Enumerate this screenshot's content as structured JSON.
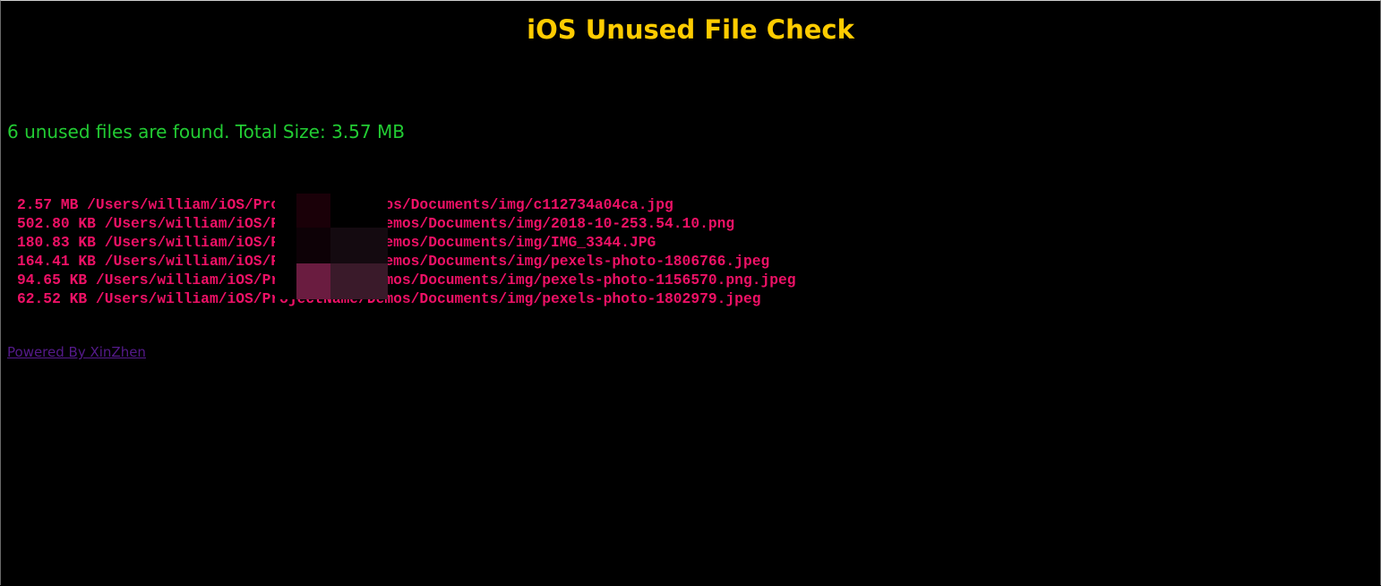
{
  "header": {
    "title": "iOS Unused File Check"
  },
  "summary": {
    "text": "6 unused files are found. Total Size: 3.57 MB"
  },
  "files": [
    {
      "line": "2.57 MB /Users/william/iOS/ProjectName/Demos/Documents/img/c112734a04ca.jpg"
    },
    {
      "line": "502.80 KB /Users/william/iOS/ProjectName/Demos/Documents/img/2018-10-253.54.10.png"
    },
    {
      "line": "180.83 KB /Users/william/iOS/ProjectName/Demos/Documents/img/IMG_3344.JPG"
    },
    {
      "line": "164.41 KB /Users/william/iOS/ProjectName/Demos/Documents/img/pexels-photo-1806766.jpeg"
    },
    {
      "line": "94.65 KB /Users/william/iOS/ProjectName/Demos/Documents/img/pexels-photo-1156570.png.jpeg"
    },
    {
      "line": "62.52 KB /Users/william/iOS/ProjectName/Demos/Documents/img/pexels-photo-1802979.jpeg"
    }
  ],
  "footer": {
    "link_label": "Powered By XinZhen"
  },
  "colors": {
    "background": "#000000",
    "title": "#ffcc00",
    "summary": "#22cc33",
    "file_text": "#ee1166",
    "link": "#551a8b"
  }
}
